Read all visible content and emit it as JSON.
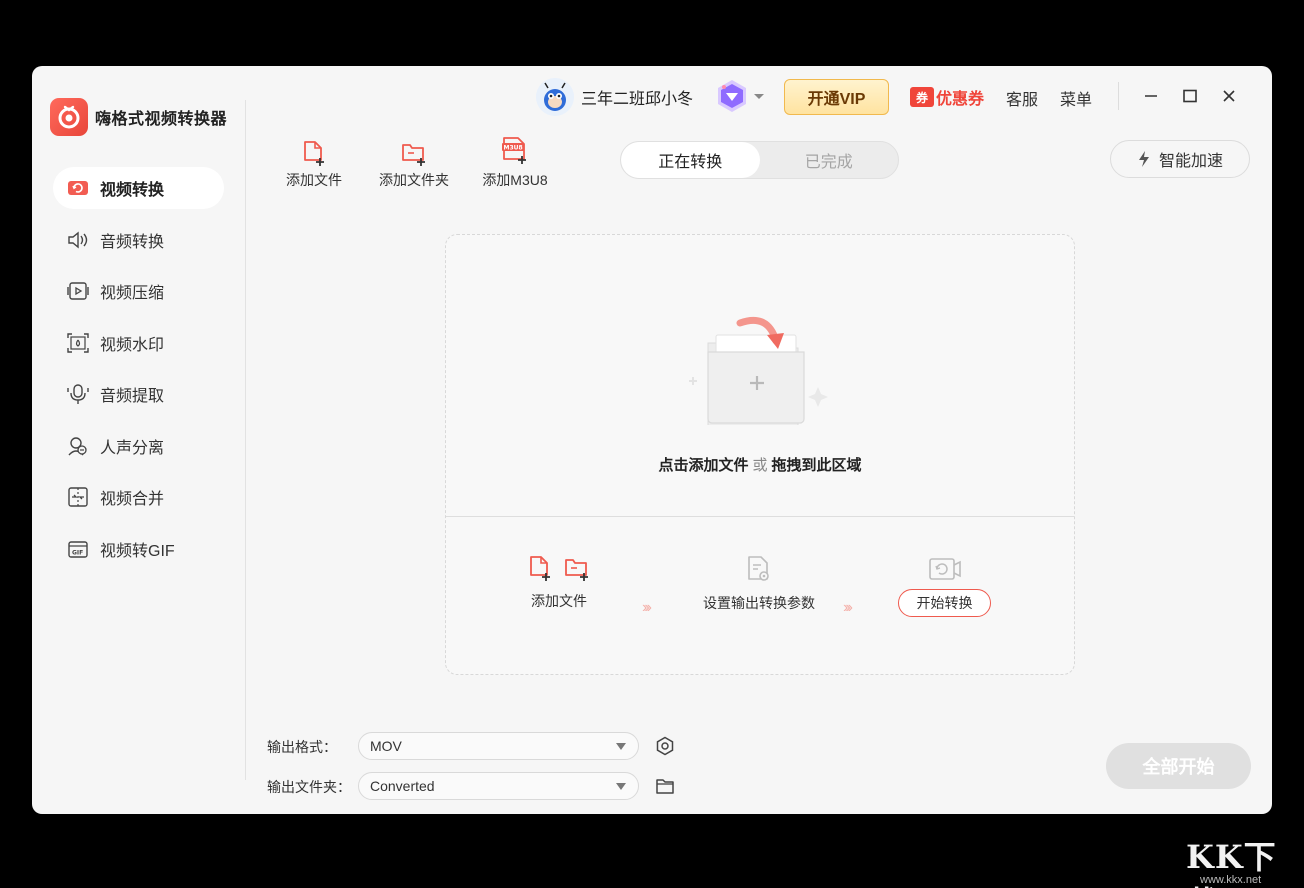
{
  "app": {
    "title": "嗨格式视频转换器"
  },
  "sidebar": {
    "items": [
      {
        "label": "视频转换",
        "icon": "video-convert-icon",
        "active": true
      },
      {
        "label": "音频转换",
        "icon": "audio-convert-icon",
        "active": false
      },
      {
        "label": "视频压缩",
        "icon": "video-compress-icon",
        "active": false
      },
      {
        "label": "视频水印",
        "icon": "video-watermark-icon",
        "active": false
      },
      {
        "label": "音频提取",
        "icon": "audio-extract-icon",
        "active": false
      },
      {
        "label": "人声分离",
        "icon": "vocal-separate-icon",
        "active": false
      },
      {
        "label": "视频合并",
        "icon": "video-merge-icon",
        "active": false
      },
      {
        "label": "视频转GIF",
        "icon": "video-to-gif-icon",
        "active": false
      }
    ]
  },
  "header": {
    "username": "三年二班邱小冬",
    "vip_button": "开通VIP",
    "coupon_tag": "券",
    "coupon": "优惠券",
    "service": "客服",
    "menu": "菜单"
  },
  "toolbar": {
    "add_file": "添加文件",
    "add_folder": "添加文件夹",
    "add_m3u8": "添加M3U8",
    "m3u8_badge": "M3U8",
    "tabs": [
      "正在转换",
      "已完成"
    ],
    "speed": "智能加速"
  },
  "drop": {
    "hint_main": "点击添加文件",
    "hint_or": "或",
    "hint_drag": "拖拽到此区域",
    "steps": [
      "添加文件",
      "设置输出转换参数",
      "开始转换"
    ]
  },
  "output": {
    "format_label": "输出格式：",
    "format_value": "MOV",
    "folder_label": "输出文件夹：",
    "folder_value": "Converted"
  },
  "start_all": "全部开始",
  "watermark": {
    "big": "KK下载",
    "small": "www.kkx.net"
  },
  "colors": {
    "accent": "#ef5a4e",
    "vip": "#f1b94e",
    "coupon": "#f0453a"
  }
}
